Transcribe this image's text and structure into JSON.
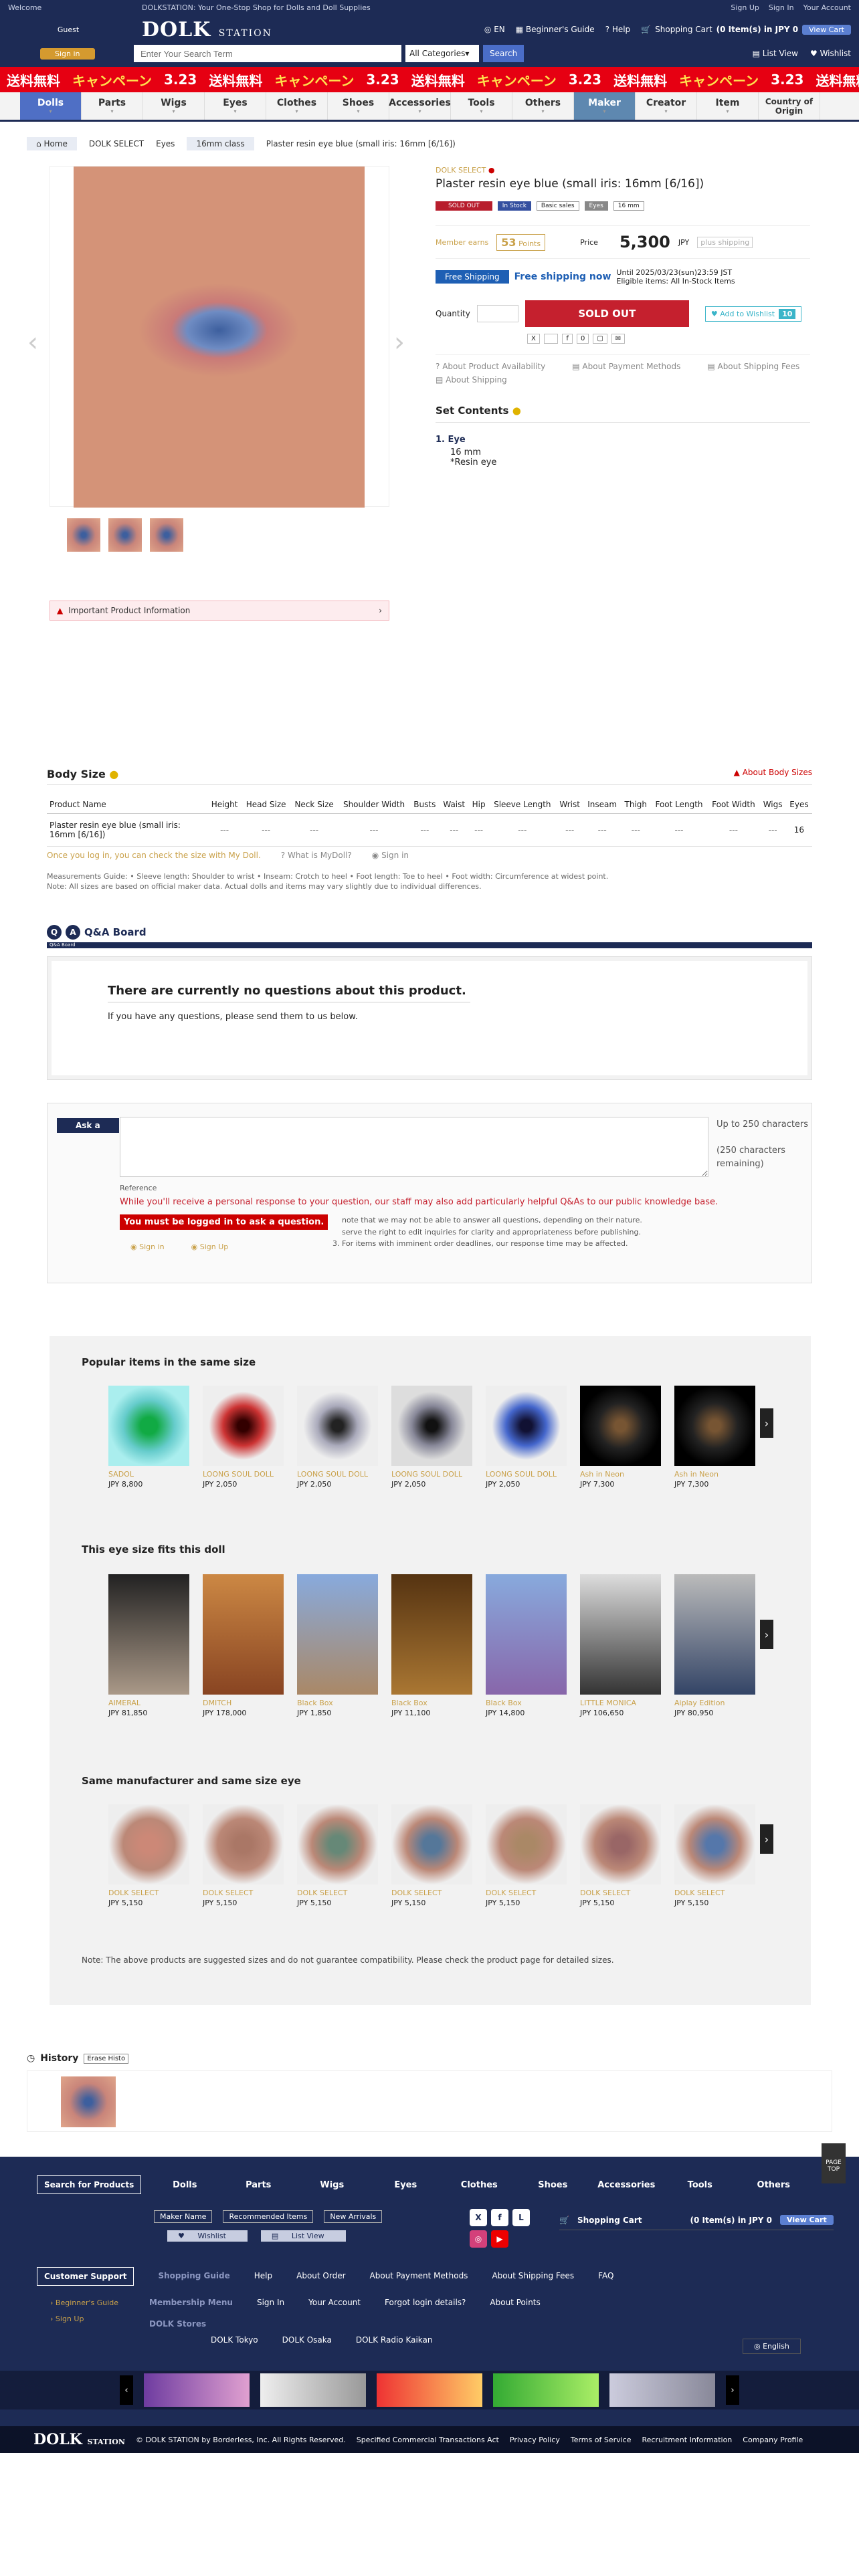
{
  "topbar": {
    "welcome": "Welcome",
    "tagline": "DOLKSTATION: Your One-Stop Shop for Dolls and Doll Supplies",
    "signup": "Sign Up",
    "signin": "Sign In",
    "account": "Your Account"
  },
  "header": {
    "guest": "Guest",
    "signin_btn": "Sign in",
    "logo": "DOLK",
    "logo_sub": "STATION",
    "lang": "EN",
    "guide": "Beginner's Guide",
    "help": "Help",
    "cart": "Shopping Cart",
    "cart_info": "(0 Item(s) in JPY 0",
    "view_cart": "View Cart"
  },
  "search": {
    "placeholder": "Enter Your Search Term",
    "category": "All Categories",
    "button": "Search",
    "list_view": "List View",
    "wishlist": "Wishlist"
  },
  "banner": {
    "text": "送料無料",
    "campaign": "キャンペーン",
    "date": "3.23"
  },
  "nav": [
    {
      "label": "Dolls"
    },
    {
      "label": "Parts"
    },
    {
      "label": "Wigs"
    },
    {
      "label": "Eyes"
    },
    {
      "label": "Clothes"
    },
    {
      "label": "Shoes"
    },
    {
      "label": "Accessories"
    },
    {
      "label": "Tools"
    },
    {
      "label": "Others"
    },
    {
      "label": "Maker"
    },
    {
      "label": "Creator"
    },
    {
      "label": "Item"
    },
    {
      "label": "Country of Origin"
    }
  ],
  "breadcrumb": [
    "Home",
    "DOLK SELECT",
    "Eyes",
    "16mm class",
    "Plaster resin eye blue (small iris: 16mm [6/16])"
  ],
  "product": {
    "brand": "DOLK SELECT",
    "title": "Plaster resin eye blue (small iris: 16mm [6/16])",
    "tags": [
      "SOLD OUT",
      "In Stock",
      "Basic sales",
      "Eyes",
      "16 mm"
    ],
    "member_earns": "Member earns",
    "points": "53",
    "points_unit": "Points",
    "price_label": "Price",
    "price": "5,300",
    "currency": "JPY",
    "plus_shipping": "plus shipping",
    "free_shipping": "Free Shipping",
    "free_now": "Free shipping now",
    "until": "Until 2025/03/23(sun)23:59 JST",
    "eligible": "Eligible items: All In-Stock Items",
    "quantity": "Quantity",
    "sold_out": "SOLD OUT",
    "add_wish": "Add to Wishlist",
    "wish_count": "10",
    "social_count": "0",
    "important": "Important Product Information"
  },
  "about_links": [
    "About Product Availability",
    "About Payment Methods",
    "About Shipping Fees",
    "About Shipping"
  ],
  "set_contents": {
    "title": "Set Contents",
    "item": "1. Eye",
    "size": "16 mm",
    "material": "*Resin eye"
  },
  "body_size": {
    "title": "Body Size",
    "about": "About Body Sizes",
    "headers": [
      "Product Name",
      "Height",
      "Head Size",
      "Neck Size",
      "Shoulder Width",
      "Busts",
      "Waist",
      "Hip",
      "Sleeve Length",
      "Wrist",
      "Inseam",
      "Thigh",
      "Foot Length",
      "Foot Width",
      "Wigs",
      "Eyes"
    ],
    "row_name": "Plaster resin eye blue (small iris: 16mm [6/16])",
    "dash": "---",
    "eyes_val": "16",
    "mydoll": "Once you log in, you can check the size with My Doll.",
    "what_mydoll": "What is MyDoll?",
    "signin": "Sign in",
    "guide": "Measurements Guide: • Sleeve length: Shoulder to wrist • Inseam: Crotch to heel • Foot length: Toe to heel • Foot width: Circumference at widest point.",
    "note": "Note: All sizes are based on official maker data. Actual dolls and items may vary slightly due to individual differences."
  },
  "qa": {
    "title": "Q&A Board",
    "bar": "Q&A Board",
    "none": "There are currently no questions about this product.",
    "send": "If you have any questions, please send them to us below.",
    "ask": "Ask a",
    "limit": "Up to 250 characters",
    "remaining": "(250 characters remaining)",
    "reference": "Reference",
    "personal": "While you'll receive a personal response to your question, our staff may also add particularly helpful Q&As to our public knowledge base.",
    "login_btn": "You must be logged in to ask a question.",
    "n1": "note that we may not be able to answer all questions, depending on their nature.",
    "n2": "serve the right to edit inquiries for clarity and appropriateness before publishing.",
    "n3": "3. For items with imminent order deadlines, our response time may be affected.",
    "signin": "Sign in",
    "signup": "Sign Up"
  },
  "reco": {
    "popular_title": "Popular items in the same size",
    "popular": [
      {
        "brand": "SADOL",
        "price": "JPY 8,800"
      },
      {
        "brand": "LOONG SOUL DOLL",
        "price": "JPY 2,050"
      },
      {
        "brand": "LOONG SOUL DOLL",
        "price": "JPY 2,050"
      },
      {
        "brand": "LOONG SOUL DOLL",
        "price": "JPY 2,050"
      },
      {
        "brand": "LOONG SOUL DOLL",
        "price": "JPY 2,050"
      },
      {
        "brand": "Ash in Neon",
        "price": "JPY 7,300"
      },
      {
        "brand": "Ash in Neon",
        "price": "JPY 7,300"
      }
    ],
    "fits_title": "This eye size fits this doll",
    "fits": [
      {
        "brand": "AIMERAL",
        "price": "JPY 81,850"
      },
      {
        "brand": "DMITCH",
        "price": "JPY 178,000"
      },
      {
        "brand": "Black Box",
        "price": "JPY 1,850"
      },
      {
        "brand": "Black Box",
        "price": "JPY 11,100"
      },
      {
        "brand": "Black Box",
        "price": "JPY 14,800"
      },
      {
        "brand": "LITTLE MONICA",
        "price": "JPY 106,650"
      },
      {
        "brand": "Aiplay Edition",
        "price": "JPY 80,950"
      }
    ],
    "same_title": "Same manufacturer and same size eye",
    "same": [
      {
        "brand": "DOLK SELECT",
        "price": "JPY 5,150"
      },
      {
        "brand": "DOLK SELECT",
        "price": "JPY 5,150"
      },
      {
        "brand": "DOLK SELECT",
        "price": "JPY 5,150"
      },
      {
        "brand": "DOLK SELECT",
        "price": "JPY 5,150"
      },
      {
        "brand": "DOLK SELECT",
        "price": "JPY 5,150"
      },
      {
        "brand": "DOLK SELECT",
        "price": "JPY 5,150"
      },
      {
        "brand": "DOLK SELECT",
        "price": "JPY 5,150"
      }
    ],
    "note": "Note: The above products are suggested sizes and do not guarantee compatibility. Please check the product page for detailed sizes."
  },
  "history": {
    "title": "History",
    "erase": "Erase Histo"
  },
  "footer": {
    "page_top": "PAGE TOP",
    "search_label": "Search for Products",
    "cats": [
      "Dolls",
      "Parts",
      "Wigs",
      "Eyes",
      "Clothes",
      "Shoes",
      "Accessories",
      "Tools",
      "Others"
    ],
    "maker": "Maker Name",
    "recommended": "Recommended Items",
    "new": "New Arrivals",
    "wishlist": "Wishlist",
    "listview": "List View",
    "cart": "Shopping Cart",
    "cart_info": "(0 Item(s) in JPY 0",
    "view_cart": "View Cart",
    "support": "Customer Support",
    "guide": "Shopping Guide",
    "help": "Help",
    "order": "About Order",
    "payment": "About Payment Methods",
    "shipping": "About Shipping Fees",
    "faq": "FAQ",
    "membership": "Membership Menu",
    "signin": "Sign In",
    "account": "Your Account",
    "forgot": "Forgot login details?",
    "points": "About Points",
    "stores": "DOLK Stores",
    "tokyo": "DOLK Tokyo",
    "osaka": "DOLK Osaka",
    "radio": "DOLK Radio Kaikan",
    "beginner": "Beginner's Guide",
    "signup": "Sign Up",
    "lang": "English",
    "copyright": "© DOLK STATION by Borderless, Inc. All Rights Reserved.",
    "legal": "Specified Commercial Transactions Act",
    "privacy": "Privacy Policy",
    "terms": "Terms of Service",
    "recruit": "Recruitment Information",
    "company": "Company Profile"
  }
}
